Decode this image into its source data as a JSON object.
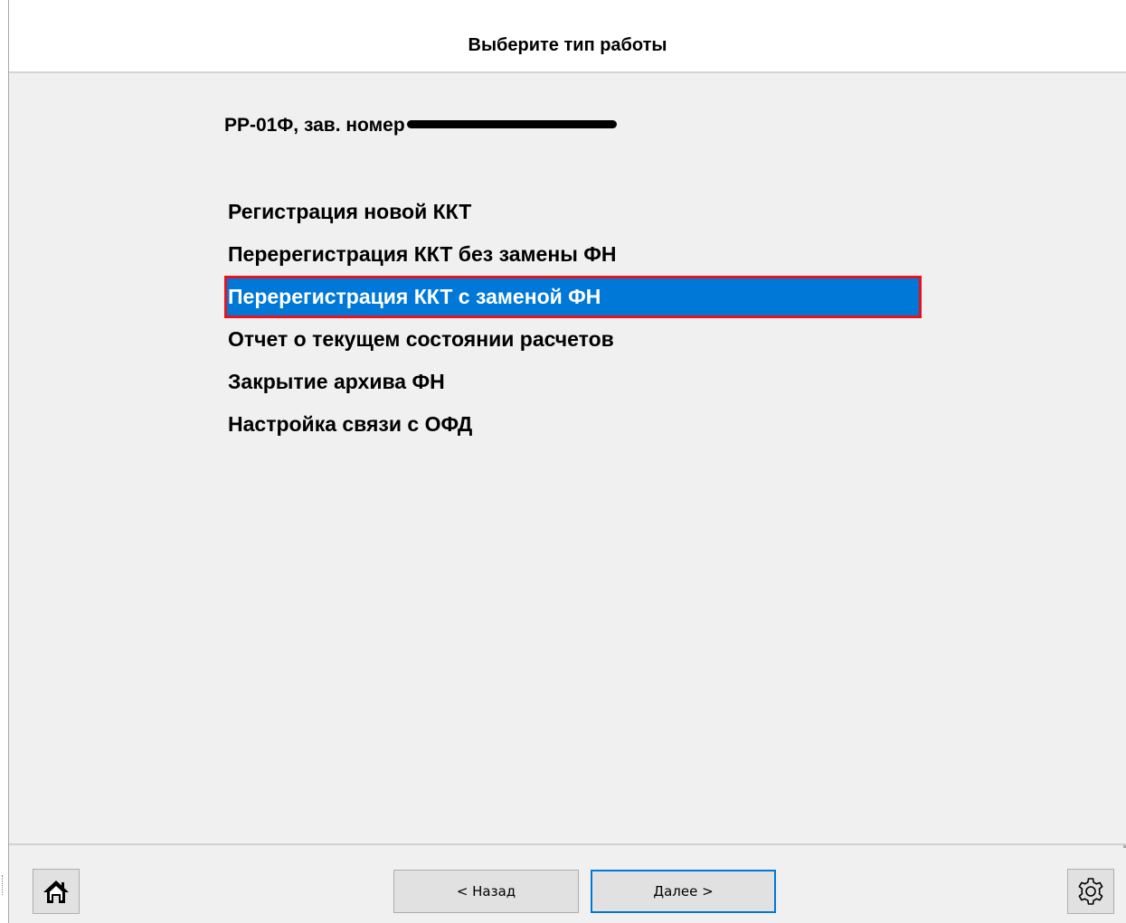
{
  "header": {
    "title": "Выберите тип работы"
  },
  "device": {
    "label": "РР-01Ф, зав. номер"
  },
  "menu": {
    "items": [
      {
        "label": "Регистрация новой ККТ",
        "selected": false
      },
      {
        "label": "Перерегистрация ККТ без замены ФН",
        "selected": false
      },
      {
        "label": "Перерегистрация ККТ с заменой ФН",
        "selected": true
      },
      {
        "label": "Отчет о текущем состоянии расчетов",
        "selected": false
      },
      {
        "label": "Закрытие архива ФН",
        "selected": false
      },
      {
        "label": "Настройка связи с ОФД",
        "selected": false
      }
    ]
  },
  "footer": {
    "home_icon": "home-icon",
    "settings_icon": "gear-icon",
    "back_label": "< Назад",
    "next_label": "Далее >"
  },
  "colors": {
    "selection": "#0078d7",
    "selection_border": "#e8121e",
    "content_bg": "#f0f0f0"
  }
}
